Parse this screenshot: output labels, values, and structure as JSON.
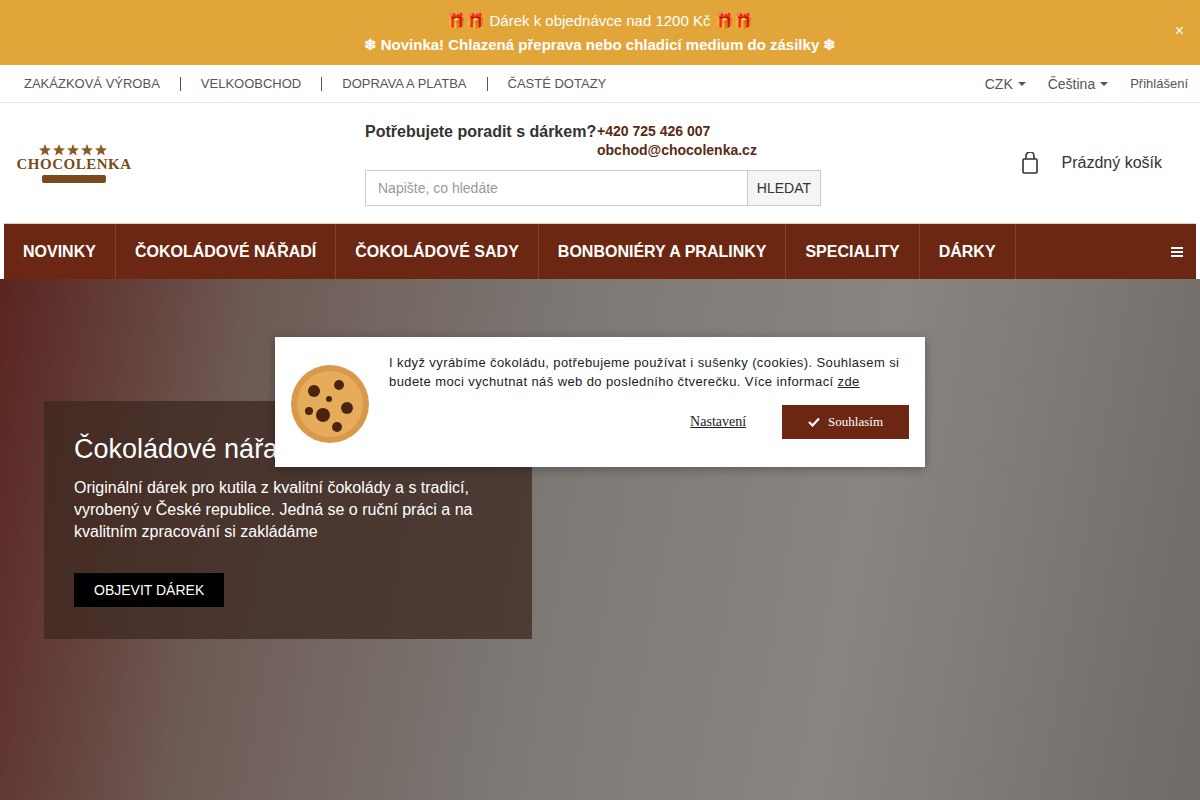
{
  "announcement": {
    "lines": [
      "🎁🎁 Dárek k objednávce nad 1200 Kč 🎁🎁",
      "❄ Novinka! Chlazená přeprava nebo chladicí medium do zásilky ❄"
    ],
    "close": "×"
  },
  "topLinks": [
    {
      "label": "ZAKÁZKOVÁ VÝROBA"
    },
    {
      "label": "VELKOOBCHOD"
    },
    {
      "label": "DOPRAVA A PLATBA"
    },
    {
      "label": "ČASTÉ DOTAZY"
    }
  ],
  "currency": "CZK",
  "language": "Čeština",
  "login": "Přihlášení",
  "header": {
    "logo": "CHOCOLENKA",
    "help": "Potřebujete poradit s dárkem?",
    "phone": "+420 725 426 007",
    "email": "obchod@chocolenka.cz",
    "searchPlaceholder": "Napište, co hledáte",
    "searchButton": "HLEDAT",
    "cart": "Prázdný košík"
  },
  "nav": [
    {
      "label": "NOVINKY"
    },
    {
      "label": "ČOKOLÁDOVÉ NÁŘADÍ"
    },
    {
      "label": "ČOKOLÁDOVÉ SADY"
    },
    {
      "label": "BONBONIÉRY A PRALINKY"
    },
    {
      "label": "SPECIALITY"
    },
    {
      "label": "DÁRKY"
    }
  ],
  "hero": {
    "title": "Čokoládové nářa",
    "text": "Originální dárek pro kutila z kvalitní čokolády a s tradicí, vyrobený v České republice. Jedná se o ruční práci a na kvalitním zpracování si zakládáme",
    "button": "OBJEVIT DÁREK"
  },
  "cookie": {
    "text": "I když vyrábíme čokoládu, potřebujeme používat i sušenky (cookies). Souhlasem si budete moci vychutnat náš web do posledního čtverečku. Více informací",
    "link": "zde",
    "settings": "Nastavení",
    "accept": "Souhlasím"
  }
}
